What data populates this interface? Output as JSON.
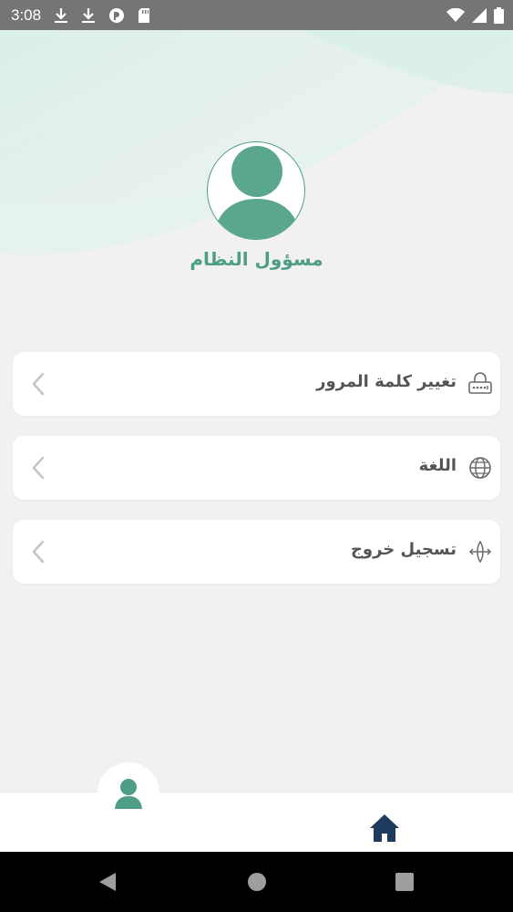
{
  "status_bar": {
    "time": "3:08",
    "icons": [
      "download-icon",
      "download-icon",
      "app-notification-icon",
      "sd-card-icon",
      "wifi-icon",
      "signal-icon",
      "battery-icon"
    ]
  },
  "profile": {
    "name": "مسؤول النظام",
    "avatar_icon": "user-icon"
  },
  "menu": {
    "items": [
      {
        "label": "تغيير كلمة المرور",
        "icon": "password-icon"
      },
      {
        "label": "اللغة",
        "icon": "globe-icon"
      },
      {
        "label": "تسجيل خروج",
        "icon": "logout-icon"
      }
    ],
    "chevron_icon": "chevron-left-icon"
  },
  "bottom_nav": {
    "items": [
      "profile-icon",
      "home-icon"
    ]
  },
  "colors": {
    "accent": "#4e9e87",
    "home_icon": "#1d3b5e",
    "text": "#555555",
    "background": "#f1f1f2"
  }
}
